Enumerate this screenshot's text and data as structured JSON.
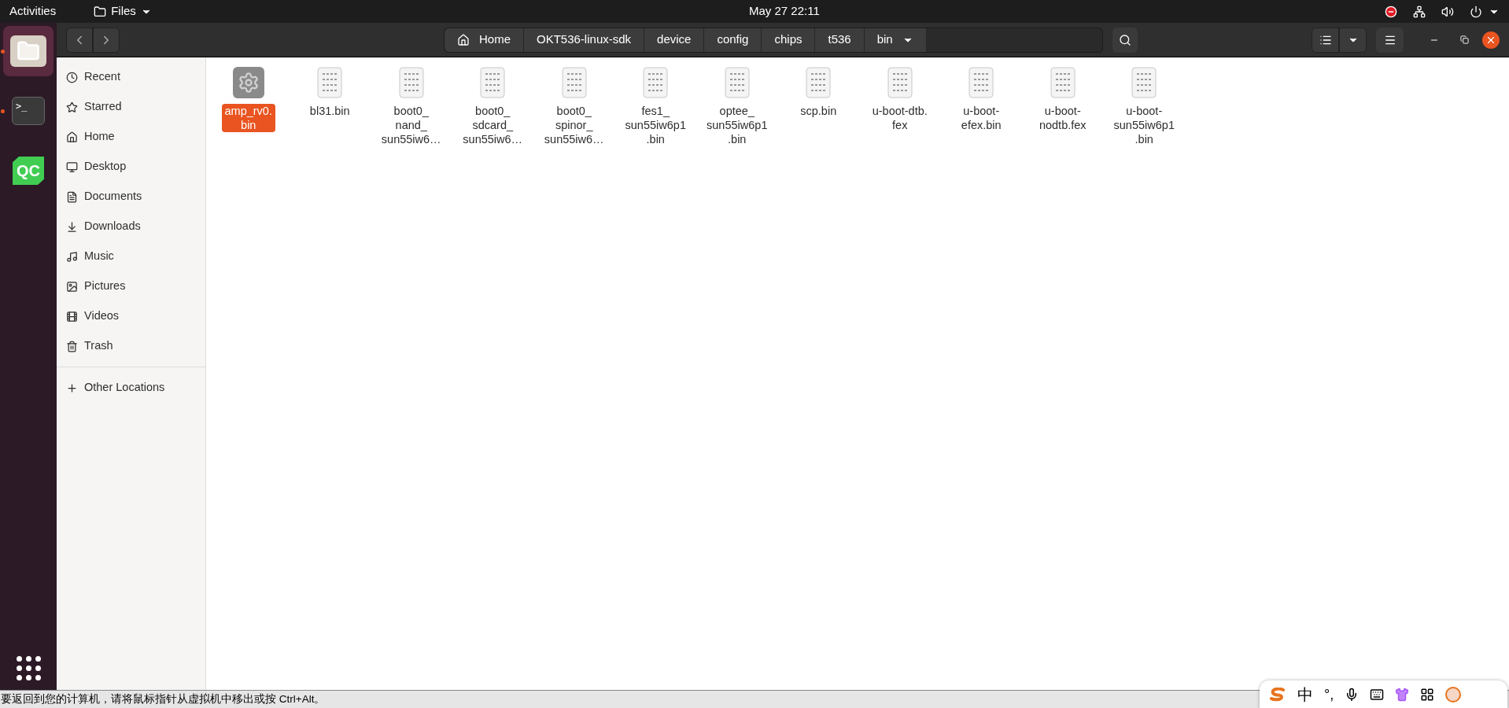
{
  "top_bar": {
    "activities": "Activities",
    "app_menu": "Files",
    "clock": "May 27  22:11"
  },
  "dock": [
    {
      "kind": "files",
      "running": true,
      "selected": true
    },
    {
      "kind": "terminal",
      "running": true,
      "selected": false,
      "label": ">_"
    },
    {
      "kind": "qt",
      "running": false,
      "selected": false,
      "label": "QC"
    }
  ],
  "path_bar": [
    "Home",
    "OKT536-linux-sdk",
    "device",
    "config",
    "chips",
    "t536",
    "bin"
  ],
  "sidebar": [
    {
      "label": "Recent",
      "kind": "recent"
    },
    {
      "label": "Starred",
      "kind": "star"
    },
    {
      "label": "Home",
      "kind": "home"
    },
    {
      "label": "Desktop",
      "kind": "desktop"
    },
    {
      "label": "Documents",
      "kind": "documents"
    },
    {
      "label": "Downloads",
      "kind": "downloads"
    },
    {
      "label": "Music",
      "kind": "music"
    },
    {
      "label": "Pictures",
      "kind": "pictures"
    },
    {
      "label": "Videos",
      "kind": "videos"
    },
    {
      "label": "Trash",
      "kind": "trash"
    },
    {
      "label": "Other Locations",
      "kind": "other"
    }
  ],
  "files": [
    {
      "lines": [
        "amp_rv0.",
        "bin"
      ],
      "kind": "settings",
      "selected": true
    },
    {
      "lines": [
        "bl31.bin"
      ],
      "kind": "binary",
      "selected": false
    },
    {
      "lines": [
        "boot0_",
        "nand_",
        "sun55iw6…"
      ],
      "kind": "binary",
      "selected": false
    },
    {
      "lines": [
        "boot0_",
        "sdcard_",
        "sun55iw6…"
      ],
      "kind": "binary",
      "selected": false
    },
    {
      "lines": [
        "boot0_",
        "spinor_",
        "sun55iw6…"
      ],
      "kind": "binary",
      "selected": false
    },
    {
      "lines": [
        "fes1_",
        "sun55iw6p1",
        ".bin"
      ],
      "kind": "binary",
      "selected": false
    },
    {
      "lines": [
        "optee_",
        "sun55iw6p1",
        ".bin"
      ],
      "kind": "binary",
      "selected": false
    },
    {
      "lines": [
        "scp.bin"
      ],
      "kind": "binary",
      "selected": false
    },
    {
      "lines": [
        "u-boot-dtb.",
        "fex"
      ],
      "kind": "binary",
      "selected": false
    },
    {
      "lines": [
        "u-boot-",
        "efex.bin"
      ],
      "kind": "binary",
      "selected": false
    },
    {
      "lines": [
        "u-boot-",
        "nodtb.fex"
      ],
      "kind": "binary",
      "selected": false
    },
    {
      "lines": [
        "u-boot-",
        "sun55iw6p1",
        ".bin"
      ],
      "kind": "binary",
      "selected": false
    }
  ],
  "vm_status": "要返回到您的计算机，请将鼠标指针从虚拟机中移出或按 Ctrl+Alt。",
  "ime": {
    "mode": "中",
    "punctuation": "°,"
  }
}
